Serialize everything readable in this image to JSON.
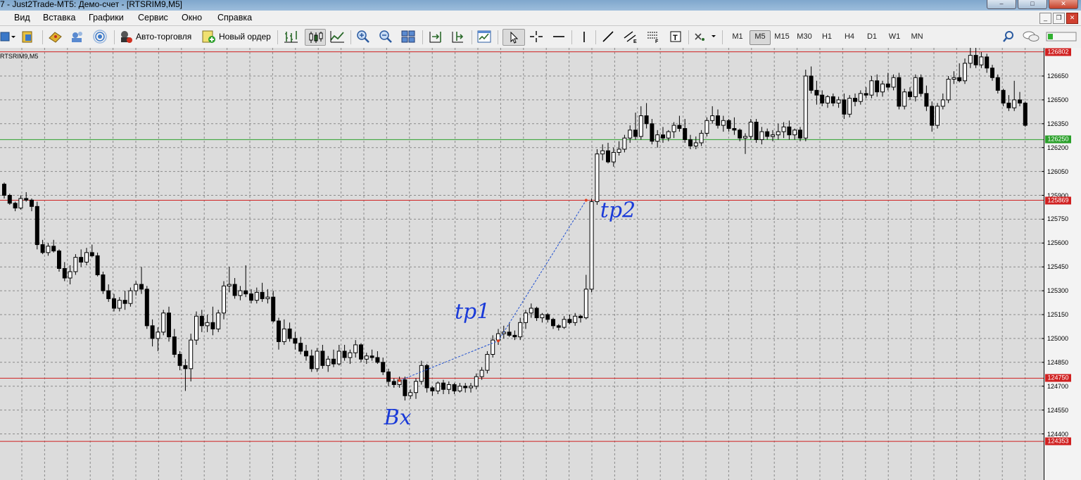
{
  "window": {
    "title": "7 - Just2Trade-MT5: Демо-счет - [RTSRIM9,M5]"
  },
  "menu": [
    "Вид",
    "Вставка",
    "Графики",
    "Сервис",
    "Окно",
    "Справка"
  ],
  "toolbar": {
    "algo_label": "Авто-торговля",
    "order_label": "Новый ордер",
    "timeframes": [
      "M1",
      "M5",
      "M15",
      "M30",
      "H1",
      "H4",
      "D1",
      "W1",
      "MN"
    ],
    "active_timeframe": "M5"
  },
  "chart": {
    "symbol_label": "RTSRIM9,M5"
  },
  "chart_data": {
    "type": "candlestick",
    "symbol": "RTSRIM9",
    "timeframe": "M5",
    "price_ticks": [
      "126650",
      "126500",
      "126350",
      "126200",
      "126050",
      "125900",
      "125750",
      "125600",
      "125450",
      "125300",
      "125150",
      "125000",
      "124850",
      "124700",
      "124550",
      "124400"
    ],
    "ylim": [
      124300,
      126920
    ],
    "horizontal_lines": [
      {
        "price": 126802,
        "label": "126802",
        "color": "#d02020"
      },
      {
        "price": 126250,
        "label": "126250",
        "color": "#2aa02a"
      },
      {
        "price": 125869,
        "label": "125869",
        "color": "#d02020"
      },
      {
        "price": 124750,
        "label": "124750",
        "color": "#d02020"
      },
      {
        "price": 124353,
        "label": "124353",
        "color": "#d02020"
      }
    ],
    "annotations": [
      {
        "text": "Вх",
        "price": 124735,
        "candle": 72
      },
      {
        "text": "tp1",
        "price": 124985,
        "candle": 90
      },
      {
        "text": "tp2",
        "price": 125869,
        "candle": 106
      }
    ],
    "candles": [
      [
        125970,
        125980,
        125880,
        125900
      ],
      [
        125900,
        125910,
        125840,
        125850
      ],
      [
        125850,
        125860,
        125800,
        125820
      ],
      [
        125820,
        125900,
        125810,
        125880
      ],
      [
        125880,
        125920,
        125860,
        125870
      ],
      [
        125870,
        125880,
        125800,
        125830
      ],
      [
        125830,
        125860,
        125560,
        125590
      ],
      [
        125590,
        125620,
        125530,
        125540
      ],
      [
        125540,
        125600,
        125520,
        125580
      ],
      [
        125580,
        125620,
        125540,
        125550
      ],
      [
        125550,
        125560,
        125420,
        125440
      ],
      [
        125440,
        125480,
        125360,
        125380
      ],
      [
        125380,
        125460,
        125340,
        125420
      ],
      [
        125420,
        125530,
        125400,
        125510
      ],
      [
        125510,
        125560,
        125450,
        125480
      ],
      [
        125480,
        125570,
        125460,
        125540
      ],
      [
        125540,
        125590,
        125510,
        125520
      ],
      [
        125520,
        125540,
        125390,
        125400
      ],
      [
        125400,
        125420,
        125280,
        125300
      ],
      [
        125300,
        125340,
        125230,
        125250
      ],
      [
        125250,
        125280,
        125170,
        125190
      ],
      [
        125190,
        125260,
        125170,
        125240
      ],
      [
        125240,
        125300,
        125180,
        125220
      ],
      [
        125220,
        125320,
        125200,
        125300
      ],
      [
        125300,
        125360,
        125270,
        125340
      ],
      [
        125340,
        125450,
        125280,
        125310
      ],
      [
        125310,
        125330,
        125060,
        125080
      ],
      [
        125080,
        125120,
        124950,
        125000
      ],
      [
        125000,
        125070,
        124920,
        125040
      ],
      [
        125040,
        125180,
        125020,
        125160
      ],
      [
        125160,
        125200,
        124980,
        125010
      ],
      [
        125010,
        125060,
        124880,
        124900
      ],
      [
        124900,
        124920,
        124800,
        124830
      ],
      [
        124830,
        124870,
        124670,
        124810
      ],
      [
        124810,
        125030,
        124730,
        124990
      ],
      [
        124990,
        125170,
        124960,
        125140
      ],
      [
        125140,
        125180,
        125040,
        125080
      ],
      [
        125080,
        125150,
        125040,
        125100
      ],
      [
        125100,
        125200,
        125020,
        125060
      ],
      [
        125060,
        125180,
        125040,
        125160
      ],
      [
        125160,
        125360,
        125120,
        125330
      ],
      [
        125330,
        125450,
        125290,
        125340
      ],
      [
        125340,
        125380,
        125250,
        125270
      ],
      [
        125270,
        125330,
        125240,
        125300
      ],
      [
        125300,
        125460,
        125260,
        125280
      ],
      [
        125280,
        125310,
        125220,
        125240
      ],
      [
        125240,
        125320,
        125220,
        125290
      ],
      [
        125290,
        125350,
        125230,
        125250
      ],
      [
        125250,
        125310,
        125220,
        125260
      ],
      [
        125260,
        125300,
        125100,
        125110
      ],
      [
        125110,
        125130,
        124930,
        124980
      ],
      [
        124980,
        125120,
        124960,
        125060
      ],
      [
        125060,
        125100,
        124980,
        125000
      ],
      [
        125000,
        125040,
        124930,
        124970
      ],
      [
        124970,
        125010,
        124900,
        124920
      ],
      [
        124920,
        124960,
        124860,
        124890
      ],
      [
        124890,
        124930,
        124790,
        124810
      ],
      [
        124810,
        124940,
        124790,
        124920
      ],
      [
        124920,
        124960,
        124810,
        124830
      ],
      [
        124830,
        124890,
        124790,
        124870
      ],
      [
        124870,
        124930,
        124820,
        124840
      ],
      [
        124840,
        124960,
        124830,
        124920
      ],
      [
        124920,
        124960,
        124860,
        124880
      ],
      [
        124880,
        124930,
        124840,
        124910
      ],
      [
        124910,
        124990,
        124880,
        124960
      ],
      [
        124960,
        124970,
        124850,
        124870
      ],
      [
        124870,
        124910,
        124840,
        124890
      ],
      [
        124890,
        124930,
        124860,
        124880
      ],
      [
        124880,
        124920,
        124840,
        124850
      ],
      [
        124850,
        124880,
        124770,
        124790
      ],
      [
        124790,
        124810,
        124700,
        124730
      ],
      [
        124730,
        124750,
        124690,
        124710
      ],
      [
        124710,
        124760,
        124690,
        124740
      ],
      [
        124740,
        124760,
        124610,
        124640
      ],
      [
        124640,
        124680,
        124620,
        124660
      ],
      [
        124660,
        124750,
        124620,
        124730
      ],
      [
        124730,
        124860,
        124710,
        124830
      ],
      [
        124830,
        124840,
        124660,
        124690
      ],
      [
        124690,
        124700,
        124640,
        124670
      ],
      [
        124670,
        124730,
        124650,
        124720
      ],
      [
        124720,
        124740,
        124650,
        124680
      ],
      [
        124680,
        124730,
        124650,
        124710
      ],
      [
        124710,
        124720,
        124650,
        124670
      ],
      [
        124670,
        124720,
        124660,
        124700
      ],
      [
        124700,
        124720,
        124660,
        124690
      ],
      [
        124690,
        124720,
        124660,
        124700
      ],
      [
        124700,
        124780,
        124680,
        124760
      ],
      [
        124760,
        124820,
        124740,
        124800
      ],
      [
        124800,
        124920,
        124780,
        124900
      ],
      [
        124900,
        125020,
        124880,
        124990
      ],
      [
        124990,
        125060,
        124960,
        125030
      ],
      [
        125030,
        125080,
        125000,
        125040
      ],
      [
        125040,
        125100,
        125010,
        125020
      ],
      [
        125020,
        125050,
        124990,
        125010
      ],
      [
        125010,
        125130,
        124990,
        125100
      ],
      [
        125100,
        125180,
        125060,
        125160
      ],
      [
        125160,
        125220,
        125130,
        125190
      ],
      [
        125190,
        125200,
        125110,
        125130
      ],
      [
        125130,
        125160,
        125100,
        125150
      ],
      [
        125150,
        125160,
        125100,
        125120
      ],
      [
        125120,
        125130,
        125060,
        125080
      ],
      [
        125080,
        125090,
        125050,
        125070
      ],
      [
        125070,
        125140,
        125060,
        125120
      ],
      [
        125120,
        125150,
        125090,
        125100
      ],
      [
        125100,
        125160,
        125080,
        125140
      ],
      [
        125140,
        125150,
        125100,
        125130
      ],
      [
        125130,
        125400,
        125120,
        125310
      ],
      [
        125310,
        125880,
        125290,
        125860
      ],
      [
        125860,
        126190,
        125840,
        126160
      ],
      [
        126160,
        126220,
        126120,
        126180
      ],
      [
        126180,
        126230,
        126100,
        126110
      ],
      [
        126110,
        126200,
        126080,
        126170
      ],
      [
        126170,
        126240,
        126150,
        126190
      ],
      [
        126190,
        126280,
        126170,
        126260
      ],
      [
        126260,
        126340,
        126230,
        126310
      ],
      [
        126310,
        126420,
        126250,
        126270
      ],
      [
        126270,
        126460,
        126250,
        126400
      ],
      [
        126400,
        126480,
        126320,
        126350
      ],
      [
        126350,
        126380,
        126220,
        126240
      ],
      [
        126240,
        126310,
        126200,
        126280
      ],
      [
        126280,
        126330,
        126230,
        126260
      ],
      [
        126260,
        126310,
        126240,
        126300
      ],
      [
        126300,
        126360,
        126260,
        126340
      ],
      [
        126340,
        126400,
        126300,
        126320
      ],
      [
        126320,
        126380,
        126230,
        126250
      ],
      [
        126250,
        126280,
        126190,
        126210
      ],
      [
        126210,
        126270,
        126190,
        126230
      ],
      [
        126230,
        126310,
        126210,
        126290
      ],
      [
        126290,
        126390,
        126270,
        126370
      ],
      [
        126370,
        126460,
        126350,
        126400
      ],
      [
        126400,
        126440,
        126320,
        126340
      ],
      [
        126340,
        126400,
        126300,
        126370
      ],
      [
        126370,
        126380,
        126300,
        126320
      ],
      [
        126320,
        126390,
        126280,
        126310
      ],
      [
        126310,
        126320,
        126240,
        126260
      ],
      [
        126260,
        126290,
        126160,
        126270
      ],
      [
        126270,
        126380,
        126250,
        126360
      ],
      [
        126360,
        126380,
        126230,
        126250
      ],
      [
        126250,
        126330,
        126220,
        126300
      ],
      [
        126300,
        126320,
        126250,
        126270
      ],
      [
        126270,
        126310,
        126240,
        126280
      ],
      [
        126280,
        126350,
        126250,
        126300
      ],
      [
        126300,
        126360,
        126260,
        126330
      ],
      [
        126330,
        126370,
        126250,
        126280
      ],
      [
        126280,
        126320,
        126250,
        126310
      ],
      [
        126310,
        126330,
        126240,
        126260
      ],
      [
        126260,
        126690,
        126240,
        126650
      ],
      [
        126650,
        126710,
        126540,
        126560
      ],
      [
        126560,
        126620,
        126470,
        126530
      ],
      [
        126530,
        126560,
        126460,
        126480
      ],
      [
        126480,
        126530,
        126450,
        126520
      ],
      [
        126520,
        126540,
        126460,
        126480
      ],
      [
        126480,
        126520,
        126450,
        126500
      ],
      [
        126500,
        126540,
        126380,
        126410
      ],
      [
        126410,
        126530,
        126390,
        126510
      ],
      [
        126510,
        126540,
        126460,
        126490
      ],
      [
        126490,
        126560,
        126470,
        126540
      ],
      [
        126540,
        126580,
        126510,
        126530
      ],
      [
        126530,
        126650,
        126510,
        126620
      ],
      [
        126620,
        126660,
        126520,
        126550
      ],
      [
        126550,
        126620,
        126520,
        126600
      ],
      [
        126600,
        126670,
        126560,
        126580
      ],
      [
        126580,
        126660,
        126560,
        126640
      ],
      [
        126640,
        126670,
        126440,
        126460
      ],
      [
        126460,
        126570,
        126440,
        126550
      ],
      [
        126550,
        126580,
        126500,
        126520
      ],
      [
        126520,
        126660,
        126490,
        126640
      ],
      [
        126640,
        126660,
        126520,
        126540
      ],
      [
        126540,
        126590,
        126430,
        126460
      ],
      [
        126460,
        126490,
        126300,
        126340
      ],
      [
        126340,
        126480,
        126320,
        126460
      ],
      [
        126460,
        126540,
        126440,
        126500
      ],
      [
        126500,
        126650,
        126480,
        126630
      ],
      [
        126630,
        126680,
        126600,
        126640
      ],
      [
        126640,
        126730,
        126610,
        126620
      ],
      [
        126620,
        126760,
        126600,
        126730
      ],
      [
        126730,
        126880,
        126700,
        126780
      ],
      [
        126780,
        126830,
        126700,
        126720
      ],
      [
        126720,
        126800,
        126700,
        126770
      ],
      [
        126770,
        126790,
        126670,
        126700
      ],
      [
        126700,
        126720,
        126620,
        126640
      ],
      [
        126640,
        126660,
        126540,
        126560
      ],
      [
        126560,
        126570,
        126460,
        126480
      ],
      [
        126480,
        126530,
        126430,
        126450
      ],
      [
        126450,
        126620,
        126430,
        126500
      ],
      [
        126500,
        126550,
        126460,
        126480
      ],
      [
        126480,
        126490,
        126330,
        126340
      ]
    ]
  }
}
